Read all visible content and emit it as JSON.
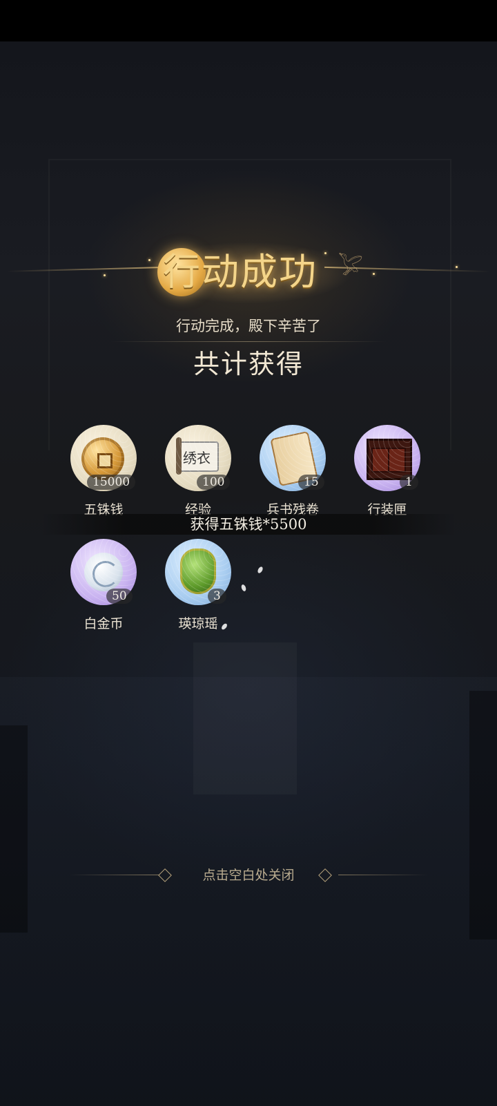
{
  "banner": {
    "title": "行动成功"
  },
  "summary": {
    "subtitle": "行动完成，殿下辛苦了",
    "heading": "共计获得"
  },
  "rewards": [
    {
      "name": "五铢钱",
      "quantity": "15000",
      "rarity": "common",
      "icon": "bronze-coin-icon"
    },
    {
      "name": "经验",
      "quantity": "100",
      "rarity": "common",
      "icon": "scroll-icon"
    },
    {
      "name": "兵书残卷",
      "quantity": "15",
      "rarity": "rare",
      "icon": "war-book-icon"
    },
    {
      "name": "行装匣",
      "quantity": "1",
      "rarity": "epic",
      "icon": "cabinet-icon"
    },
    {
      "name": "白金币",
      "quantity": "50",
      "rarity": "epic",
      "icon": "platinum-coin-icon"
    },
    {
      "name": "瑛琼瑶",
      "quantity": "3",
      "rarity": "rare",
      "icon": "jade-pendant-icon"
    }
  ],
  "toast": {
    "message": "获得五铢钱*5500"
  },
  "footer": {
    "close_hint": "点击空白处关闭"
  },
  "colors": {
    "title_gold": "#f4d58a",
    "common_disc": "#e6dcc2",
    "rare_disc": "#a9cdf0",
    "epic_disc": "#c9b3f0"
  }
}
